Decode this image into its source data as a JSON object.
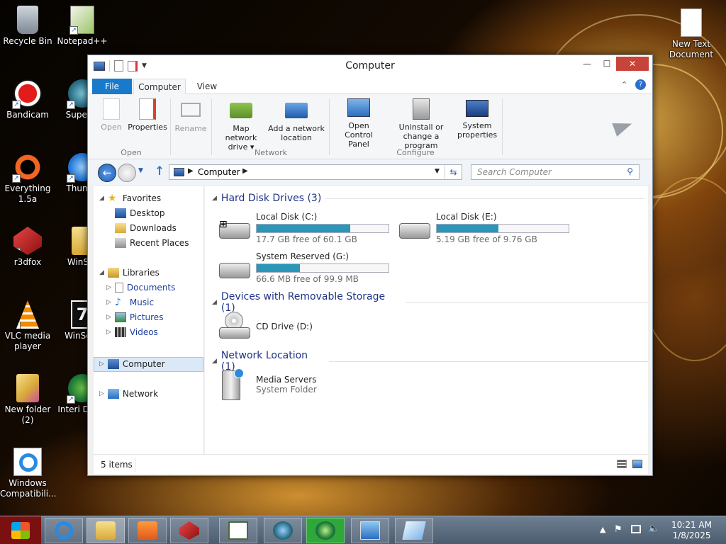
{
  "desktop": {
    "icons": [
      {
        "label": "Recycle Bin"
      },
      {
        "label": "Notepad++"
      },
      {
        "label": "Bandicam"
      },
      {
        "label": "Superm"
      },
      {
        "label": "Everything 1.5a"
      },
      {
        "label": "Thunde"
      },
      {
        "label": "r3dfox"
      },
      {
        "label": "WinSet"
      },
      {
        "label": "VLC media player"
      },
      {
        "label": "WinSetu"
      },
      {
        "label": "New folder (2)"
      },
      {
        "label": "Interi Down"
      },
      {
        "label": "Windows Compatibili..."
      },
      {
        "label": "New Text Document"
      }
    ]
  },
  "window": {
    "title": "Computer",
    "tabs": [
      {
        "label": "File"
      },
      {
        "label": "Computer"
      },
      {
        "label": "View"
      }
    ],
    "ribbon": {
      "buttons": [
        {
          "label": "Open"
        },
        {
          "label": "Properties"
        },
        {
          "label": "Rename"
        },
        {
          "label": "Map network drive ▾"
        },
        {
          "label": "Add a network location"
        },
        {
          "label": "Open Control Panel"
        },
        {
          "label": "Uninstall or change a program"
        },
        {
          "label": "System properties"
        }
      ],
      "groups": [
        {
          "label": "Open"
        },
        {
          "label": "Network"
        },
        {
          "label": "Configure"
        }
      ]
    },
    "address": {
      "path": "Computer",
      "search_placeholder": "Search Computer"
    },
    "nav": {
      "favorites": "Favorites",
      "desktop": "Desktop",
      "downloads": "Downloads",
      "recent": "Recent Places",
      "libraries": "Libraries",
      "documents": "Documents",
      "music": "Music",
      "pictures": "Pictures",
      "videos": "Videos",
      "computer": "Computer",
      "network": "Network"
    },
    "sections": {
      "hdd": "Hard Disk Drives (3)",
      "removable": "Devices with Removable Storage (1)",
      "network": "Network Location (1)"
    },
    "drives": [
      {
        "name": "Local Disk (C:)",
        "free": "17.7 GB free of 60.1 GB",
        "used_fraction": 0.71
      },
      {
        "name": "Local Disk (E:)",
        "free": "5.19 GB free of 9.76 GB",
        "used_fraction": 0.47
      },
      {
        "name": "System Reserved (G:)",
        "free": "66.6 MB free of 99.9 MB",
        "used_fraction": 0.33
      }
    ],
    "cd": {
      "name": "CD Drive (D:)"
    },
    "media": {
      "name": "Media Servers",
      "sub": "System Folder"
    },
    "status": {
      "items": "5 items"
    }
  },
  "taskbar": {
    "time": "10:21 AM",
    "date": "1/8/2025"
  }
}
